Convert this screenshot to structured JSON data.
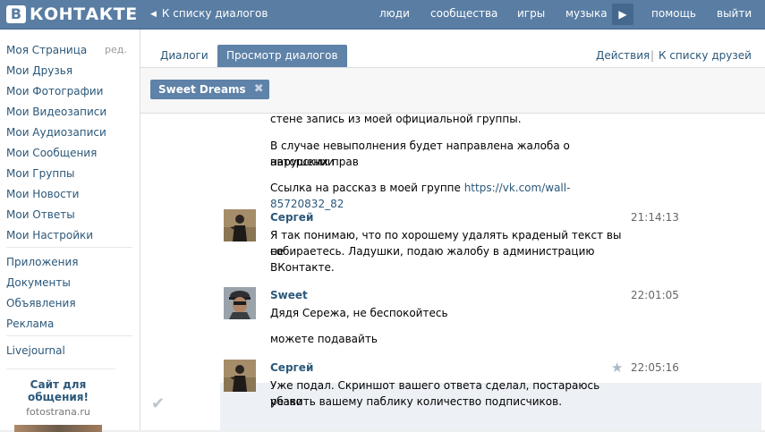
{
  "header": {
    "logo_letter": "В",
    "logo_text": "КОНТАКТЕ",
    "back_link": "К списку диалогов",
    "nav": {
      "people": "люди",
      "communities": "сообщества",
      "games": "игры",
      "music": "музыка",
      "help": "помощь",
      "exit": "выйти"
    }
  },
  "sidebar": {
    "items": [
      "Моя Страница",
      "Мои Друзья",
      "Мои Фотографии",
      "Мои Видеозаписи",
      "Мои Аудиозаписи",
      "Мои Сообщения",
      "Мои Группы",
      "Мои Новости",
      "Мои Ответы",
      "Мои Настройки"
    ],
    "edit_label": "ред.",
    "extra_items": [
      "Приложения",
      "Документы",
      "Объявления",
      "Реклама"
    ],
    "more_items": [
      "Livejournal"
    ],
    "promo": {
      "title_line1": "Сайт для",
      "title_line2": "общения!",
      "subtitle": "fotostrana.ru"
    }
  },
  "tabs": {
    "dialogs": "Диалоги",
    "view": "Просмотр диалогов",
    "actions": "Действия",
    "separator": "|",
    "to_friends": "К списку друзей"
  },
  "chip": {
    "label": "Sweet Dreams",
    "close": "✖"
  },
  "messages": {
    "m0_line": "стене запись из моей официальной группы.",
    "m1_line1": "В случае невыполнения будет направлена жалоба о нарушении",
    "m1_line2": "авторских прав",
    "m2_prefix": "Ссылка на рассказ в моей группе ",
    "m2_link": "https://vk.com/wall-85720832_82",
    "m3": {
      "author": "Сергей",
      "time": "21:14:13",
      "line1": "Я так понимаю, что по хорошему удалять краденый текст вы не",
      "line2": "собираетесь. Ладушки, подаю жалобу в администрацию",
      "line3": "ВКонтакте."
    },
    "m4": {
      "author": "Sweet",
      "time": "22:01:05",
      "line1": "Дядя Сережа, не беспокойтесь",
      "line2": "можете подавайть"
    },
    "m5": {
      "author": "Сергей",
      "time": "22:05:16",
      "line1": "Уже подал. Скриншот вашего ответа сделал, постараюсь резко",
      "line2": "убавить вашему паблику количество подписчиков."
    }
  }
}
